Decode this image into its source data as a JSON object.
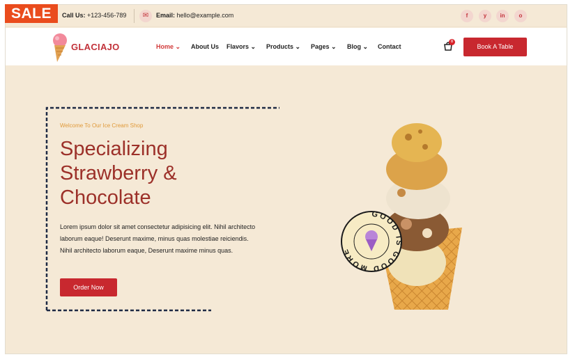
{
  "sale_label": "SALE",
  "topbar": {
    "call_label": "Call Us:",
    "call_value": "+123-456-789",
    "email_label": "Email:",
    "email_value": "hello@example.com",
    "social": [
      "f",
      "y",
      "in",
      "o"
    ]
  },
  "brand": {
    "name": "GLACIAJO"
  },
  "nav": {
    "items": [
      {
        "label": "Home",
        "has_dropdown": true,
        "active": true
      },
      {
        "label": "About Us",
        "has_dropdown": false,
        "active": false
      },
      {
        "label": "Flavors",
        "has_dropdown": true,
        "active": false
      },
      {
        "label": "Products",
        "has_dropdown": true,
        "active": false
      },
      {
        "label": "Pages",
        "has_dropdown": true,
        "active": false
      },
      {
        "label": "Blog",
        "has_dropdown": true,
        "active": false
      },
      {
        "label": "Contact",
        "has_dropdown": false,
        "active": false
      }
    ],
    "cart_count": "0",
    "book_label": "Book A Table"
  },
  "hero": {
    "kicker": "Welcome To Our Ice Cream Shop",
    "headline_lines": [
      "Specializing",
      "Strawberry &",
      "Chocolate"
    ],
    "body": "Lorem ipsum dolor sit amet consectetur adipisicing elit. Nihil architecto laborum eaque! Deserunt maxime, minus quas molestiae reiciendis. Nihil architecto laborum eaque, Deserunt maxime minus quas.",
    "cta_label": "Order Now",
    "badge_text": "GOOD IS GOOD MORE "
  },
  "colors": {
    "accent": "#c8282f",
    "headline": "#9c3029",
    "kicker": "#e09a3a",
    "background": "#f5e9d6",
    "sale": "#ea4c1d"
  }
}
